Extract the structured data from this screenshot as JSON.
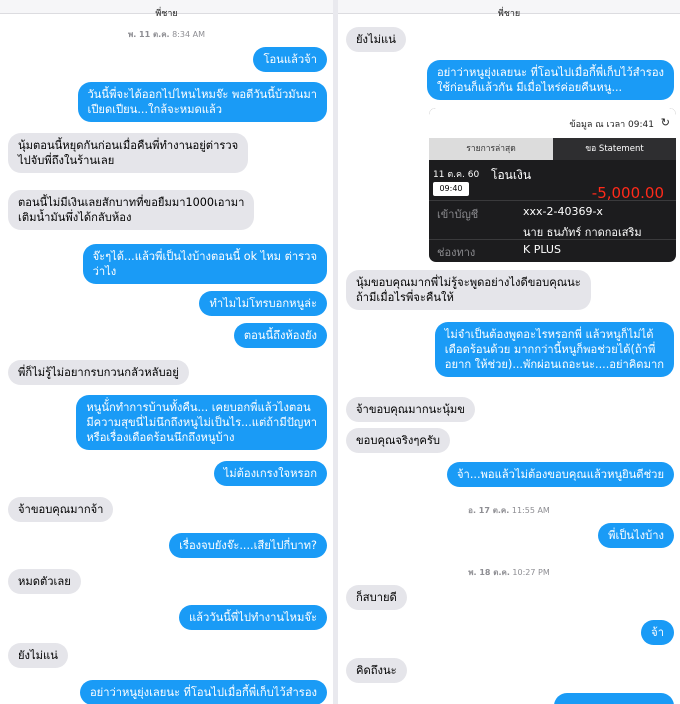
{
  "left": {
    "header": "พี่ชาย",
    "timestamp": {
      "day": "พ. 11 ต.ค.",
      "time": "8:34 AM"
    },
    "messages": [
      "โอนแล้วจ้า",
      "วันนี้พี่จะได้ออกไปไหนไหมจ๊ะ พอดีวันนี้บ้วมันมา\nเปียดเปียน...ใกล้จะหมดแล้ว",
      "นุ้มตอนนี้หยุดกันก่อนเมื่อคืนพี่ทำงานอยู่ต่ารวจ\nไปจับพี่ถึงในร้านเลย",
      "ตอนนี้ไม่มีเงินเลยสักบาทที่ขอยืมมา1000เอามา\nเติมน้ำมันพึ่งได้กลับห้อง",
      "จ๊ะๆได้...แล้วพี่เป็นไงบ้างตอนนี้ ok ไหม ต่ารวจ\nว่าไง",
      "ทำไมไม่โทรบอกหนูล่ะ",
      "ตอนนี้ถึงห้องยัง",
      "พี่ก็ไม่รู้ไม่อยากรบกวนกลัวหลับอยู่",
      "หนูนั้่กทำการบ้านทั้งคืน... เคยบอกพี่แล้วไงตอน\nมีความสุขนี่ไม่นึกถึงหนูไม่เป็นไร...แต่ถ้ามีปัญหา\nหรือเรื่องเดือดร้อนนึกถึงหนูบ้าง",
      "ไม่ต้องเกรงใจหรอก",
      "จ้าขอบคุณมากจ้า",
      "เรื่องจบยังจ๊ะ....เสียไปกี่บาท?",
      "หมดตัวเลย",
      "แล้ววันนี้พี่ไปทำงานไหมจ๊ะ",
      "ยังไม่แน่",
      "อย่าว่าหนูยุ่งเลยนะ ที่โอนไปเมื่อกี้พี่เก็บไว้สำรอง"
    ]
  },
  "right": {
    "header": "พี่ชาย",
    "messages": [
      "ยังไม่แน่",
      "อย่าว่าหนูยุ่งเลยนะ ที่โอนไปเมื่อกี้พี่เก็บไว้สำรอง\nใช้ก่อนก็แล้วกัน มีเมื่อไหร่ค่อยคืนหนู...",
      "นุ้มขอบคุณมากพี่ไม่รู้จะพูดอย่างไงดีขอบคุณนะ\nถ้ามีเมื่อไรพี่จะคืนให้",
      "ไม่จำเป็นต้องพูดอะไรหรอกพี่ แล้วหนูก็ไม่ได้\nเดือดร้อนด้วย มากกว่านี้หนูก็พอช่วยได้(ถ้าพี่\nอยาก ให้ช่วย)...พักผ่อนเถอะนะ....อย่าคิดมาก",
      "จ้าขอบคุณมากนะนุ้มข",
      "ขอบคุณจริงๆครับ",
      "จ้า...พอแล้วไม่ต้องขอบคุณแล้วหนูยินดีช่วย",
      "พี่เป็นไงบ้าง",
      "ก็สบายดี",
      "จ้า",
      "คิดถึงนะ"
    ],
    "timestamps": [
      {
        "day": "อ. 17 ต.ค.",
        "time": "11:55 AM"
      },
      {
        "day": "พ. 18 ต.ค.",
        "time": "10:27 PM"
      }
    ],
    "bank": {
      "as_of": "ข้อมูล ณ เวลา 09:41",
      "tab_recent": "รายการล่าสุด",
      "tab_statement": "ขอ Statement",
      "date": "11 ต.ค. 60",
      "time": "09:40",
      "type": "โอนเงิน",
      "amount": "-5,000.00",
      "to_label": "เข้าบัญชี",
      "account": "xxx-2-40369-x",
      "name": "นาย ธนภัทร์ กาดกอเสริม",
      "channel_label": "ช่องทาง",
      "channel": "K PLUS"
    }
  }
}
